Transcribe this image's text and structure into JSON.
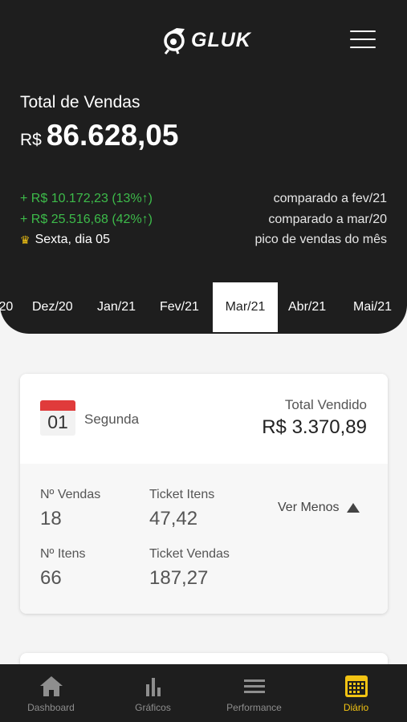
{
  "header": {
    "logo_text": "GLUK",
    "total_label": "Total de Vendas",
    "currency": "R$",
    "total_amount": "86.628,05",
    "comparisons": [
      {
        "value": "+ R$ 10.172,23 (13%↑)",
        "label": "comparado a fev/21"
      },
      {
        "value": "+ R$ 25.516,68 (42%↑)",
        "label": "comparado a mar/20"
      }
    ],
    "peak": {
      "text": "Sexta, dia 05",
      "label": "pico de vendas do mês",
      "icon": "crown-icon"
    },
    "accent_color": "#f2c313",
    "positive_color": "#3dbb4a"
  },
  "months": {
    "items": [
      "/20",
      "Dez/20",
      "Jan/21",
      "Fev/21",
      "Mar/21",
      "Abr/21",
      "Mai/21"
    ],
    "selected": "Mar/21"
  },
  "day_card": {
    "day_number": "01",
    "weekday": "Segunda",
    "total_label": "Total Vendido",
    "total_value": "R$ 3.370,89",
    "stats": {
      "vendas_label": "Nº Vendas",
      "vendas_value": "18",
      "ticket_itens_label": "Ticket Itens",
      "ticket_itens_value": "47,42",
      "itens_label": "Nº Itens",
      "itens_value": "66",
      "ticket_vendas_label": "Ticket Vendas",
      "ticket_vendas_value": "187,27"
    },
    "toggle_label": "Ver Menos"
  },
  "tabbar": {
    "items": [
      {
        "label": "Dashboard",
        "icon": "home-icon"
      },
      {
        "label": "Gráficos",
        "icon": "bar-chart-icon"
      },
      {
        "label": "Performance",
        "icon": "menu-lines-icon"
      },
      {
        "label": "Diário",
        "icon": "calendar-icon"
      }
    ],
    "active": "Diário"
  }
}
